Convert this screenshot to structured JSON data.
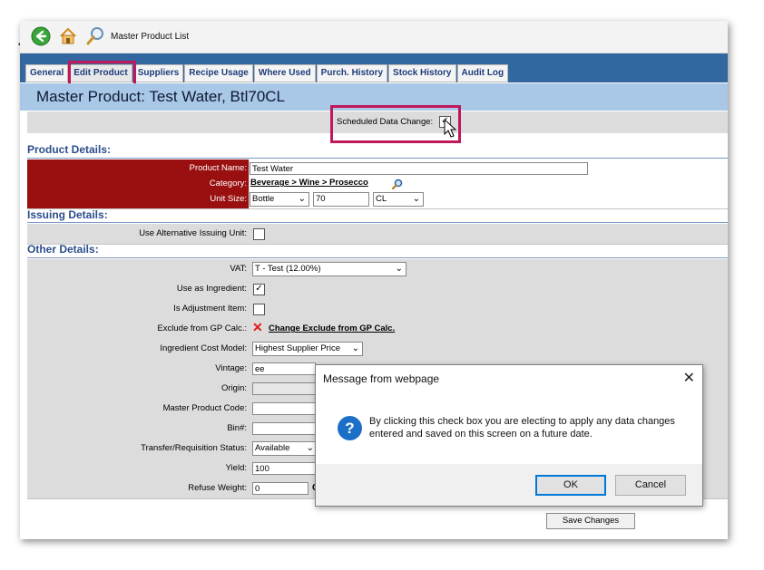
{
  "window": {
    "title": "Master Product List"
  },
  "tabs": [
    {
      "label": "General"
    },
    {
      "label": "Edit Product"
    },
    {
      "label": "Suppliers"
    },
    {
      "label": "Recipe Usage"
    },
    {
      "label": "Where Used"
    },
    {
      "label": "Purch. History"
    },
    {
      "label": "Stock History"
    },
    {
      "label": "Audit Log"
    }
  ],
  "header": {
    "title": "Master Product: Test Water, Btl70CL"
  },
  "scheduled": {
    "label": "Scheduled Data Change:",
    "checked": "✓"
  },
  "sections": {
    "product": "Product Details:",
    "issuing": "Issuing Details:",
    "other": "Other Details:"
  },
  "product": {
    "name_label": "Product Name:",
    "name_value": "Test Water",
    "category_label": "Category:",
    "category_value": "Beverage > Wine > Prosecco",
    "unit_label": "Unit Size:",
    "unit_type": "Bottle",
    "unit_qty": "70",
    "unit_measure": "CL"
  },
  "issuing": {
    "alt_unit_label": "Use Alternative Issuing Unit:"
  },
  "other": {
    "vat_label": "VAT:",
    "vat_value": "T - Test (12.00%)",
    "ingredient_label": "Use as Ingredient:",
    "ingredient_checked": "✓",
    "adjustment_label": "Is Adjustment Item:",
    "gp_label": "Exclude from GP Calc.:",
    "gp_link": "Change Exclude from GP Calc.",
    "cost_model_label": "Ingredient Cost Model:",
    "cost_model_value": "Highest Supplier Price",
    "vintage_label": "Vintage:",
    "vintage_value": "ee",
    "origin_label": "Origin:",
    "code_label": "Master Product Code:",
    "bin_label": "Bin#:",
    "transfer_label": "Transfer/Requisition Status:",
    "transfer_value": "Available",
    "yield_label": "Yield:",
    "yield_value": "100",
    "refuse_label": "Refuse Weight:",
    "refuse_value": "0",
    "refuse_trailing": "C"
  },
  "save_label": "Save Changes",
  "dialog": {
    "title": "Message from webpage",
    "message": "By clicking this check box you are electing to apply any data changes entered and saved on this screen on a future date.",
    "ok": "OK",
    "cancel": "Cancel"
  },
  "colors": {
    "accent_bar": "#3367a0",
    "title_bar": "#a9c7e6",
    "label_red": "#9a1010",
    "highlight": "#c0185a",
    "section_text": "#2a4d8c"
  },
  "icons": [
    "back-arrow-icon",
    "home-icon",
    "search-icon",
    "magnifier-icon",
    "red-x-icon",
    "question-icon",
    "close-icon",
    "chevron-down-icon"
  ]
}
